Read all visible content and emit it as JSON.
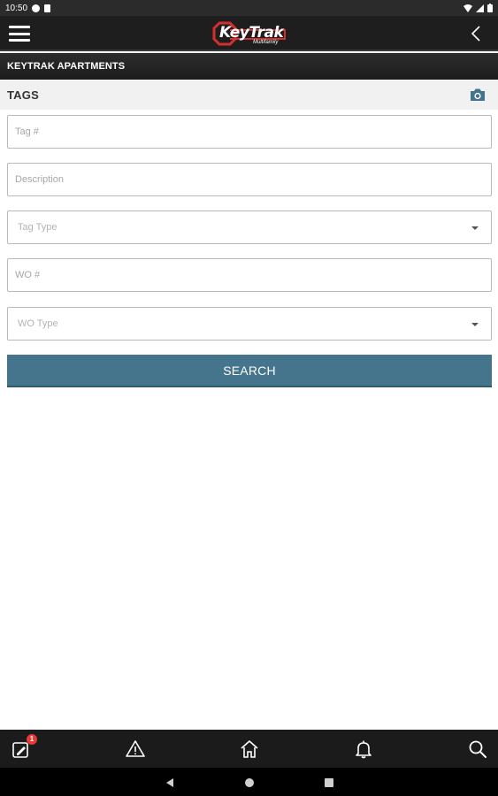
{
  "status_bar": {
    "time": "10:50"
  },
  "header": {
    "logo_text": "KeyTrak",
    "logo_subtext": "Multifamily"
  },
  "site": {
    "name": "KEYTRAK APARTMENTS"
  },
  "section": {
    "title": "TAGS"
  },
  "form": {
    "tag_placeholder": "Tag #",
    "description_placeholder": "Description",
    "tag_type_placeholder": "Tag Type",
    "wo_placeholder": "WO #",
    "wo_type_placeholder": "WO Type",
    "search_label": "SEARCH"
  },
  "bottom_nav": {
    "items": [
      {
        "icon": "tags-icon",
        "badge": "1"
      },
      {
        "icon": "alert-triangle-icon"
      },
      {
        "icon": "home-icon"
      },
      {
        "icon": "bell-icon"
      },
      {
        "icon": "search-icon"
      }
    ]
  },
  "colors": {
    "accent": "#45758d",
    "header_bg": "#1e1e1e",
    "badge": "#e53935"
  }
}
